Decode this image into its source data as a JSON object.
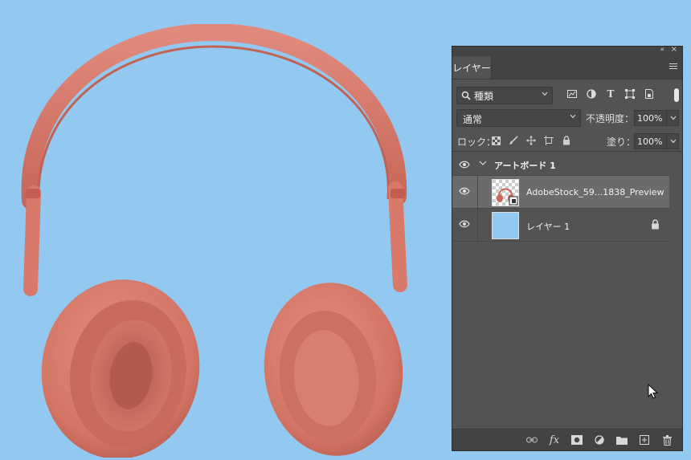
{
  "panel": {
    "tab_label": "レイヤー",
    "filter": {
      "selected": "種類"
    },
    "blend_mode": {
      "selected": "通常"
    },
    "opacity": {
      "label": "不透明度：",
      "value": "100%"
    },
    "lock": {
      "label": "ロック："
    },
    "fill": {
      "label": "塗り：",
      "value": "100%"
    },
    "layers": [
      {
        "name": "アートボード 1",
        "type": "artboard",
        "visible": true
      },
      {
        "name": "AdobeStock_59...1838_Preview",
        "type": "smart-object",
        "visible": true,
        "selected": true
      },
      {
        "name": "レイヤー 1",
        "type": "pixel",
        "visible": true,
        "locked": true,
        "fill_color": "#93c9f0"
      }
    ]
  },
  "colors": {
    "canvas_background": "#93c9f0",
    "panel_background": "#535353",
    "selected_layer": "#6b6b6b",
    "headphone": "#d8786a"
  }
}
